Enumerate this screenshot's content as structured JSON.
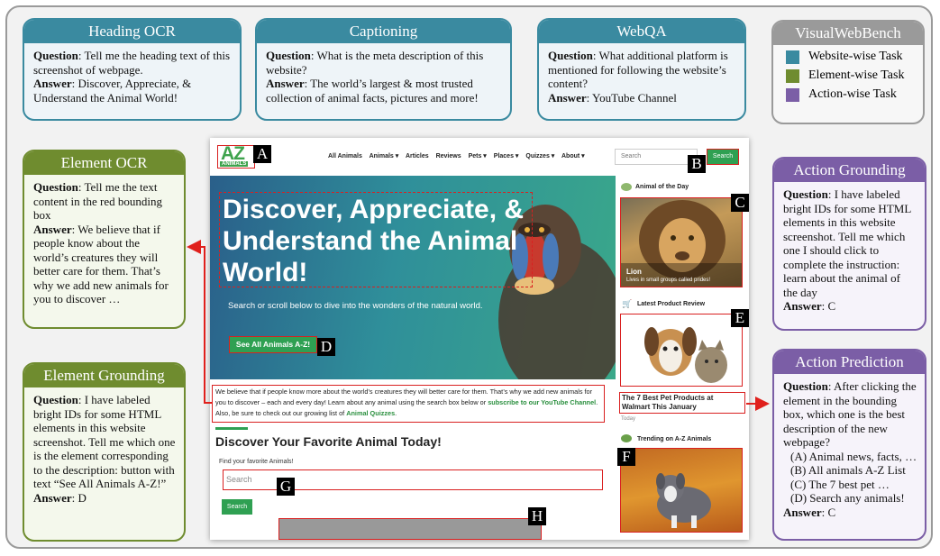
{
  "legend": {
    "title": "VisualWebBench",
    "items": [
      {
        "label": "Website-wise Task",
        "color": "#3a8aa0"
      },
      {
        "label": "Element-wise Task",
        "color": "#6f8c2f"
      },
      {
        "label": "Action-wise Task",
        "color": "#7b5ea6"
      }
    ]
  },
  "labels": {
    "question": "Question",
    "answer": "Answer"
  },
  "cards": {
    "heading_ocr": {
      "title": "Heading OCR",
      "question": ": Tell me the heading text of this screenshot of webpage.",
      "answer": ": Discover, Appreciate, & Understand the Animal World!"
    },
    "captioning": {
      "title": "Captioning",
      "question": ": What is the meta description of this website?",
      "answer": ": The world’s largest & most trusted collection of animal facts, pictures and more!"
    },
    "webqa": {
      "title": "WebQA",
      "question": ": What additional platform is mentioned for following the website’s content?",
      "answer": ": YouTube Channel"
    },
    "element_ocr": {
      "title": "Element OCR",
      "question": ": Tell me the text content in the red bounding box",
      "answer": ": We believe that if people know about the world’s creatures they will better care for them. That’s why we add new animals for you to discover …"
    },
    "element_grounding": {
      "title": "Element Grounding",
      "question": ": I have labeled bright IDs for some HTML elements in this website screenshot. Tell me which one is the element corresponding to the description: button with text “See All Animals A-Z!”",
      "answer": ": D"
    },
    "action_grounding": {
      "title": "Action Grounding",
      "question": ": I have labeled bright IDs for some HTML elements in this website screenshot. Tell me which one I should click to complete the instruction: learn about the animal of the day",
      "answer": ": C"
    },
    "action_prediction": {
      "title": "Action Prediction",
      "question": ": After clicking the element in the bounding box, which one is the best description of the new webpage?",
      "options": [
        "(A) Animal news, facts, …",
        "(B) All animals A-Z List",
        "(C) The 7 best pet …",
        "(D) Search any animals!"
      ],
      "answer": ": C"
    }
  },
  "site": {
    "logo_text": "AZ",
    "logo_sub": "ANIMALS",
    "nav": [
      "All Animals",
      "Animals ▾",
      "Articles",
      "Reviews",
      "Pets ▾",
      "Places ▾",
      "Quizzes ▾",
      "About ▾"
    ],
    "search_placeholder": "Search",
    "search_button": "Search",
    "hero_title": "Discover, Appreciate, & Understand the Animal World!",
    "hero_sub": "Search or scroll below to dive into the wonders of the natural world.",
    "hero_cta": "See All Animals A-Z!",
    "intro_a": "We believe that if people know more about the world’s creatures they will better care for them. That’s why we add new animals for you to discover – each and every day! Learn about any animal using the search box below or ",
    "intro_link1": "subscribe to our YouTube Channel",
    "intro_b": ". Also, be sure to check out our growing list of ",
    "intro_link2": "Animal Quizzes",
    "intro_c": ".",
    "discover": "Discover Your Favorite Animal Today!",
    "find_label": "Find your favorite Animals!",
    "big_search_placeholder": "Search",
    "big_search_button": "Search",
    "sidebar": {
      "aotd_label": "Animal of the Day",
      "lion_name": "Lion",
      "lion_caption": "Lives in small groups called prides!",
      "review_label": "Latest Product Review",
      "review_title": "The 7 Best Pet Products at Walmart This January",
      "review_date": "Today",
      "trending_label": "Trending on A-Z Animals"
    }
  },
  "tags": {
    "A": "A",
    "B": "B",
    "C": "C",
    "D": "D",
    "E": "E",
    "F": "F",
    "G": "G",
    "H": "H"
  },
  "colors": {
    "highlight_red": "#d92020",
    "site_green": "#2fa052"
  }
}
